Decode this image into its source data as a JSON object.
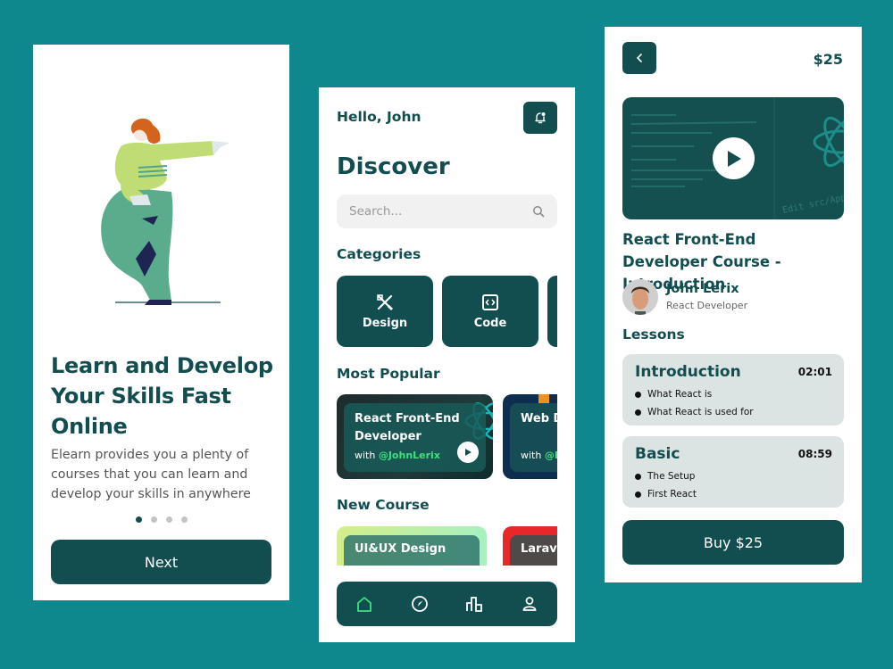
{
  "colors": {
    "background": "#0e878d",
    "primary": "#124d50",
    "accent": "#3ce27c",
    "lesson_bg": "#dce3e3"
  },
  "onboarding": {
    "title": "Learn and Develop Your Skills Fast Online",
    "description": "Elearn provides you a plenty of courses that you can learn and develop your skills in anywhere",
    "pagination": {
      "total": 4,
      "active": 1
    },
    "next_label": "Next",
    "illustration": "woman-pointing-illustration"
  },
  "discover": {
    "greeting": "Hello, John",
    "notification_icon": "bell-icon",
    "title": "Discover",
    "search_placeholder": "Search...",
    "categories_title": "Categories",
    "categories": [
      {
        "label": "Design",
        "icon": "design-tools-icon"
      },
      {
        "label": "Code",
        "icon": "code-icon"
      },
      {
        "label": "",
        "icon": ""
      }
    ],
    "popular_title": "Most Popular",
    "popular": [
      {
        "title": "React Front-End Developer",
        "with": "with",
        "author": "@JohnLerix"
      },
      {
        "title": "Web Develo",
        "with": "with",
        "author": "@E"
      }
    ],
    "new_title": "New Course",
    "new_courses": [
      {
        "title": "UI&UX Design"
      },
      {
        "title": "Larave"
      }
    ],
    "nav": [
      {
        "name": "home",
        "active": true
      },
      {
        "name": "explore",
        "active": false
      },
      {
        "name": "stats",
        "active": false
      },
      {
        "name": "profile",
        "active": false
      }
    ]
  },
  "course": {
    "price": "$25",
    "title": "React Front-End Developer Course - Introduction",
    "instructor": {
      "name": "John Lerix",
      "role": "React Developer"
    },
    "video_caption": "Edit src/App.js",
    "lessons_title": "Lessons",
    "lessons": [
      {
        "name": "Introduction",
        "duration": "02:01",
        "items": [
          "What React is",
          "What React is used for"
        ]
      },
      {
        "name": "Basic",
        "duration": "08:59",
        "items": [
          "The Setup",
          "First React"
        ]
      }
    ],
    "buy_label": "Buy $25"
  }
}
